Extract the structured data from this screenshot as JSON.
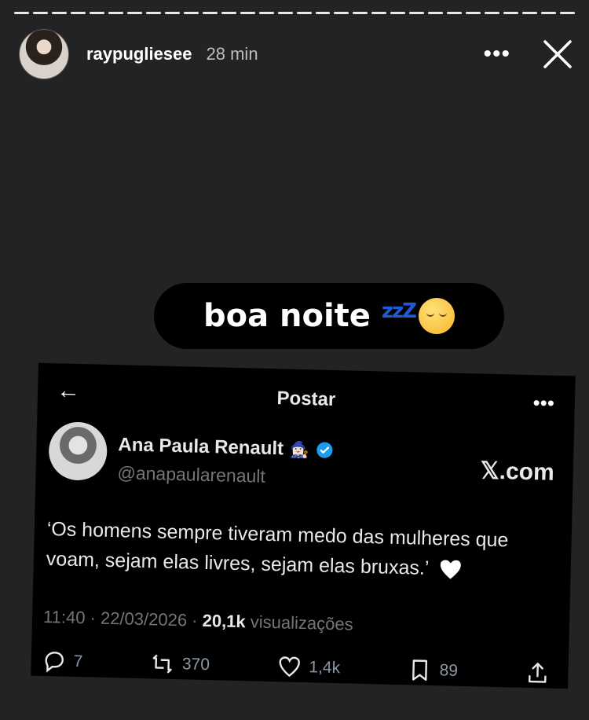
{
  "story": {
    "username": "raypugliesee",
    "time": "28 min",
    "more_label": "•••",
    "close_icon": "close-icon"
  },
  "sticker": {
    "text": "boa noite",
    "zzz": "zzZ",
    "emoji": "sleeping-face-emoji"
  },
  "tweet": {
    "header_title": "Postar",
    "back_icon": "arrow-left-icon",
    "more_label": "•••",
    "author_name": "Ana Paula Renault",
    "author_emoji": "🧙🏻‍♀️",
    "handle": "@anapaularenault",
    "source": "𝕏.com",
    "text": "‘Os homens sempre tiveram medo das mulheres que voam, sejam elas livres, sejam elas bruxas.’",
    "timestamp": "11:40 · 22/03/2026 · ",
    "views_count": "20,1k",
    "views_label": " visualizações",
    "replies": "7",
    "reposts": "370",
    "likes": "1,4k",
    "bookmarks": "89",
    "colors": {
      "verified": "#1d9bf0",
      "muted": "#71767b"
    }
  }
}
